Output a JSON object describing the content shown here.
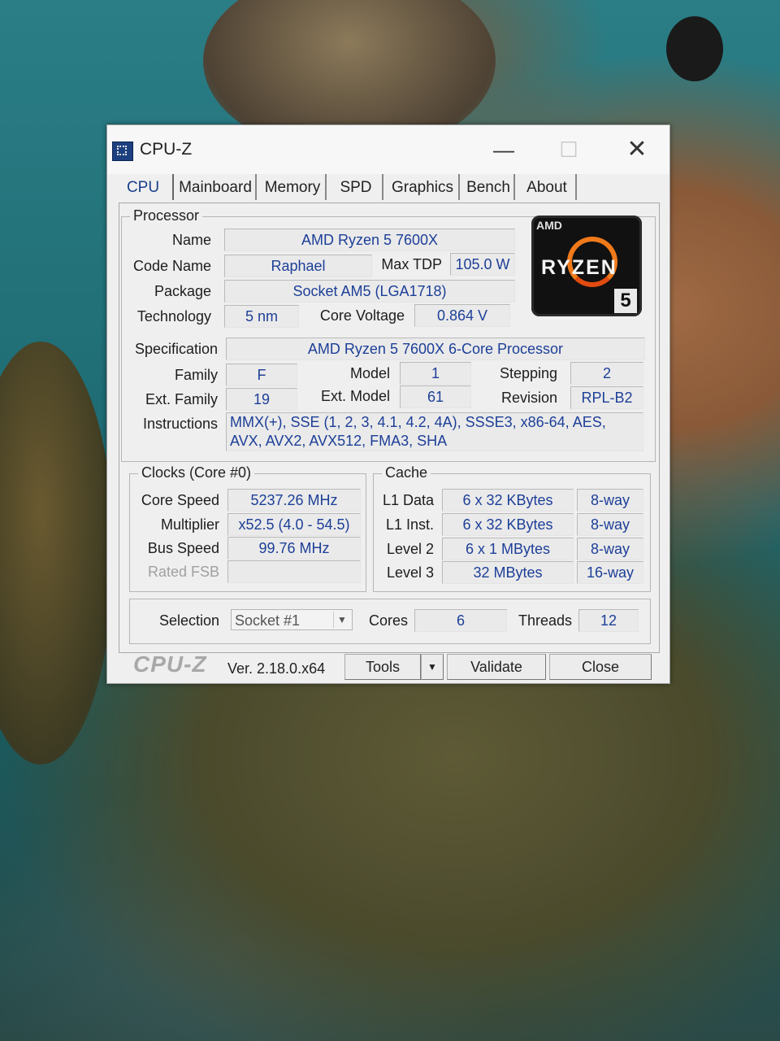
{
  "window": {
    "title": "CPU-Z",
    "minimize": "—",
    "maximize": "☐",
    "close": "✕"
  },
  "tabs": [
    "CPU",
    "Mainboard",
    "Memory",
    "SPD",
    "Graphics",
    "Bench",
    "About"
  ],
  "processor": {
    "legend": "Processor",
    "name_label": "Name",
    "name": "AMD Ryzen 5 7600X",
    "codename_label": "Code Name",
    "codename": "Raphael",
    "maxtdp_label": "Max TDP",
    "maxtdp": "105.0 W",
    "package_label": "Package",
    "package": "Socket AM5 (LGA1718)",
    "technology_label": "Technology",
    "technology": "5 nm",
    "corevoltage_label": "Core Voltage",
    "corevoltage": "0.864 V",
    "spec_label": "Specification",
    "spec": "AMD Ryzen 5 7600X 6-Core Processor",
    "family_label": "Family",
    "family": "F",
    "model_label": "Model",
    "model": "1",
    "stepping_label": "Stepping",
    "stepping": "2",
    "extfamily_label": "Ext. Family",
    "extfamily": "19",
    "extmodel_label": "Ext. Model",
    "extmodel": "61",
    "revision_label": "Revision",
    "revision": "RPL-B2",
    "instructions_label": "Instructions",
    "instructions_line1": "MMX(+), SSE (1, 2, 3, 4.1, 4.2, 4A), SSSE3, x86-64, AES,",
    "instructions_line2": "AVX, AVX2, AVX512, FMA3, SHA"
  },
  "logo": {
    "brand": "AMD",
    "line": "RYZEN",
    "tier": "5"
  },
  "clocks": {
    "legend": "Clocks (Core #0)",
    "corespeed_label": "Core Speed",
    "corespeed": "5237.26 MHz",
    "multiplier_label": "Multiplier",
    "multiplier": "x52.5 (4.0 - 54.5)",
    "busspeed_label": "Bus Speed",
    "busspeed": "99.76 MHz",
    "ratedfsb_label": "Rated FSB",
    "ratedfsb": ""
  },
  "cache": {
    "legend": "Cache",
    "rows": [
      {
        "label": "L1 Data",
        "size": "6 x 32 KBytes",
        "ways": "8-way"
      },
      {
        "label": "L1 Inst.",
        "size": "6 x 32 KBytes",
        "ways": "8-way"
      },
      {
        "label": "Level 2",
        "size": "6 x 1 MBytes",
        "ways": "8-way"
      },
      {
        "label": "Level 3",
        "size": "32 MBytes",
        "ways": "16-way"
      }
    ]
  },
  "selection": {
    "label": "Selection",
    "value": "Socket #1",
    "cores_label": "Cores",
    "cores": "6",
    "threads_label": "Threads",
    "threads": "12"
  },
  "footer": {
    "brand": "CPU-Z",
    "version": "Ver. 2.18.0.x64",
    "tools": "Tools",
    "validate": "Validate",
    "close": "Close"
  }
}
